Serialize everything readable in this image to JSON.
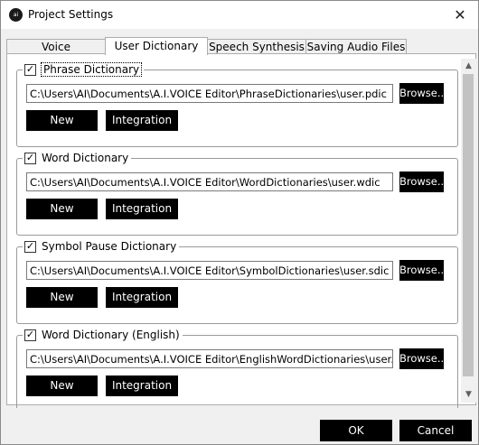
{
  "window": {
    "title": "Project Settings",
    "icon": "app-logo-icon",
    "close": "✕"
  },
  "tabs": [
    {
      "label": "Voice",
      "active": false
    },
    {
      "label": "User Dictionary",
      "active": true
    },
    {
      "label": "Speech Synthesis",
      "active": false
    },
    {
      "label": "Saving Audio Files",
      "active": false
    }
  ],
  "groups": [
    {
      "label": "Phrase Dictionary",
      "checked": true,
      "path": "C:\\Users\\AI\\Documents\\A.I.VOICE Editor\\PhraseDictionaries\\user.pdic",
      "browse": "Browse...",
      "new": "New",
      "integration": "Integration"
    },
    {
      "label": "Word Dictionary",
      "checked": true,
      "path": "C:\\Users\\AI\\Documents\\A.I.VOICE Editor\\WordDictionaries\\user.wdic",
      "browse": "Browse...",
      "new": "New",
      "integration": "Integration"
    },
    {
      "label": "Symbol Pause Dictionary",
      "checked": true,
      "path": "C:\\Users\\AI\\Documents\\A.I.VOICE Editor\\SymbolDictionaries\\user.sdic",
      "browse": "Browse...",
      "new": "New",
      "integration": "Integration"
    },
    {
      "label": "Word Dictionary (English)",
      "checked": true,
      "path": "C:\\Users\\AI\\Documents\\A.I.VOICE Editor\\EnglishWordDictionaries\\user.wdic_",
      "browse": "Browse...",
      "new": "New",
      "integration": "Integration"
    }
  ],
  "footer": {
    "ok": "OK",
    "cancel": "Cancel"
  }
}
